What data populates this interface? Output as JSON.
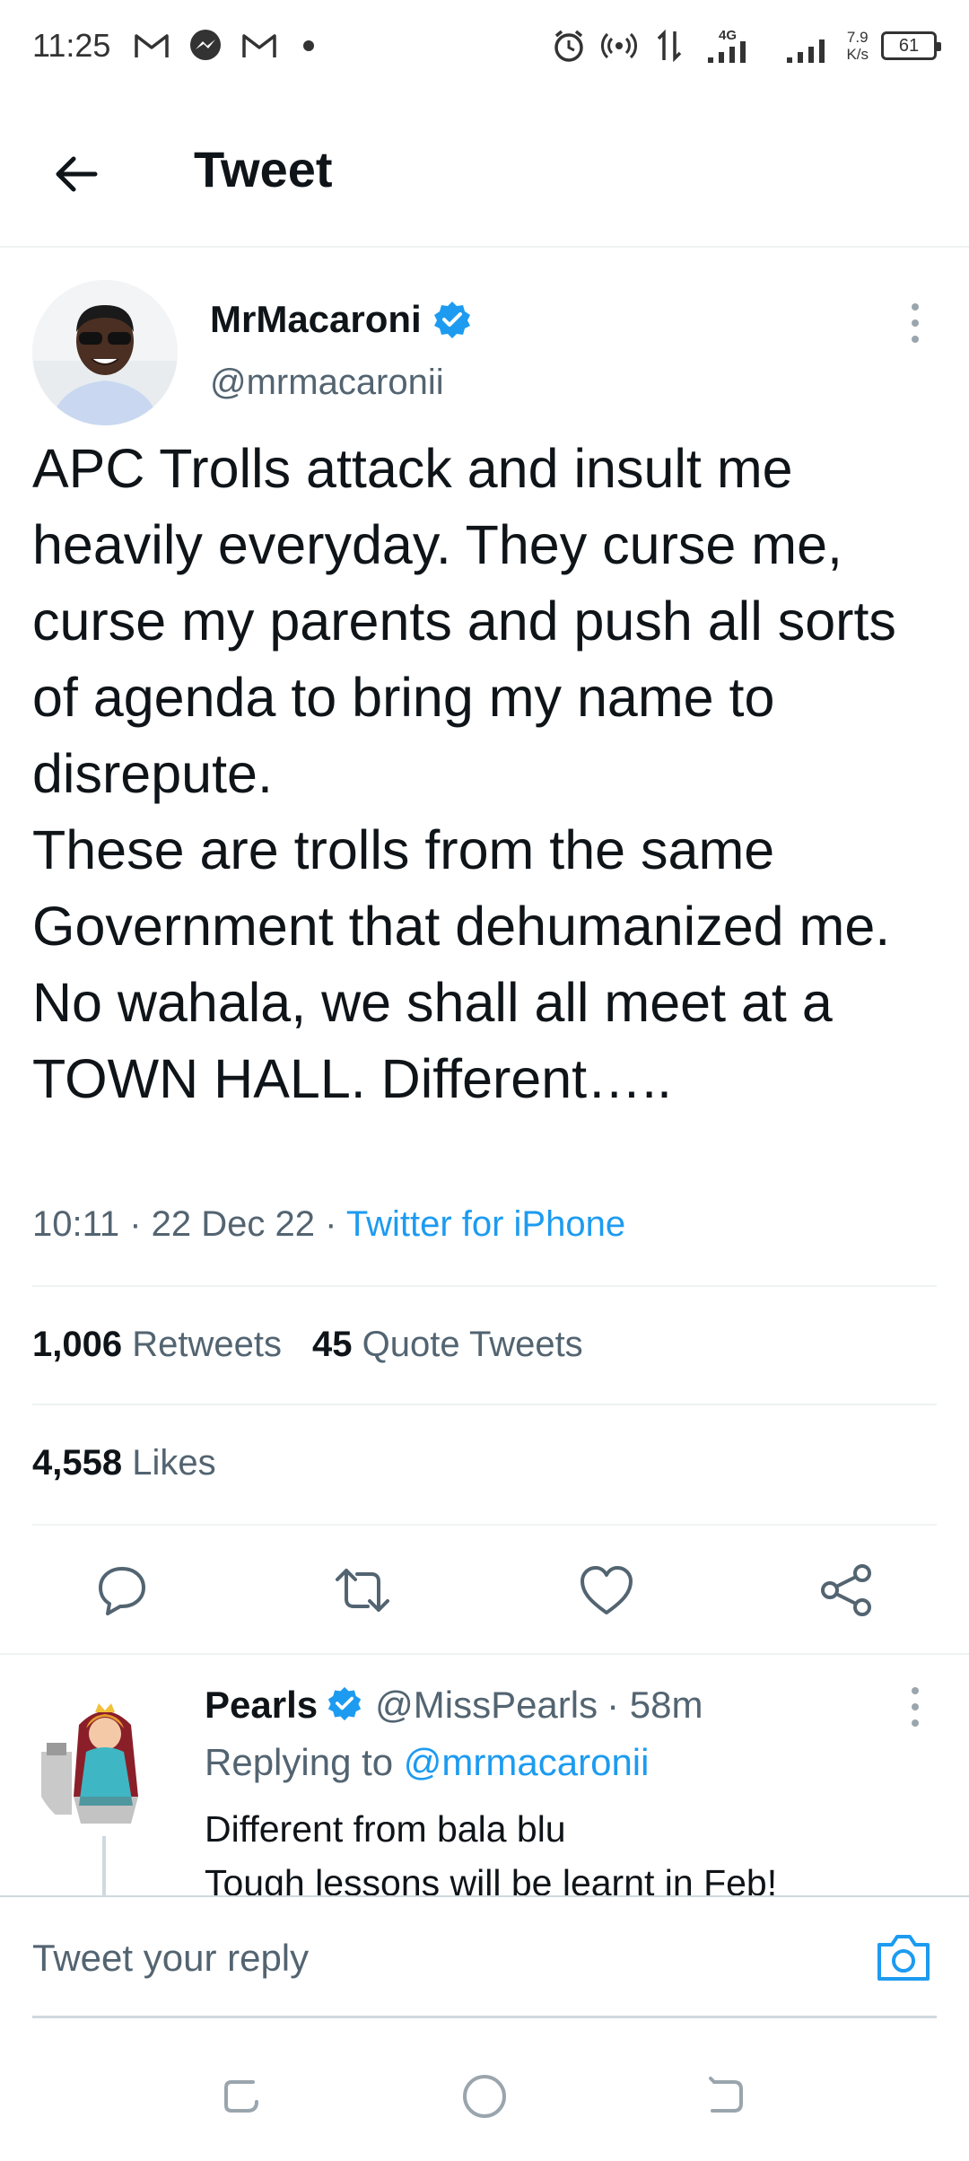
{
  "status_bar": {
    "time": "11:25",
    "network_speed": "7.9",
    "network_speed_unit": "K/s",
    "network_type": "4G",
    "battery": "61"
  },
  "header": {
    "title": "Tweet"
  },
  "tweet": {
    "author_name": "MrMacaroni",
    "author_handle": "@mrmacaronii",
    "text": "APC Trolls attack and insult me heavily everyday. They curse me, curse my parents and push all sorts of agenda to bring my name to disrepute.\nThese are trolls from the same Government that dehumanized me.\nNo wahala, we shall all meet at a TOWN HALL. Different…..",
    "time": "10:11 · 22 Dec 22 · ",
    "source": "Twitter for iPhone",
    "retweets_count": "1,006",
    "retweets_label": "Retweets",
    "quotes_count": "45",
    "quotes_label": "Quote Tweets",
    "likes_count": "4,558",
    "likes_label": "Likes"
  },
  "reply": {
    "author_name": "Pearls",
    "author_handle": "@MissPearls",
    "time": "· 58m",
    "replying_prefix": "Replying to ",
    "replying_to": "@mrmacaronii",
    "text": "Different from bala blu\nTough lessons will be learnt in Feb!"
  },
  "compose": {
    "placeholder": "Tweet your reply"
  },
  "colors": {
    "accent": "#1d9bf0",
    "text": "#0f1419",
    "secondary": "#536471"
  }
}
